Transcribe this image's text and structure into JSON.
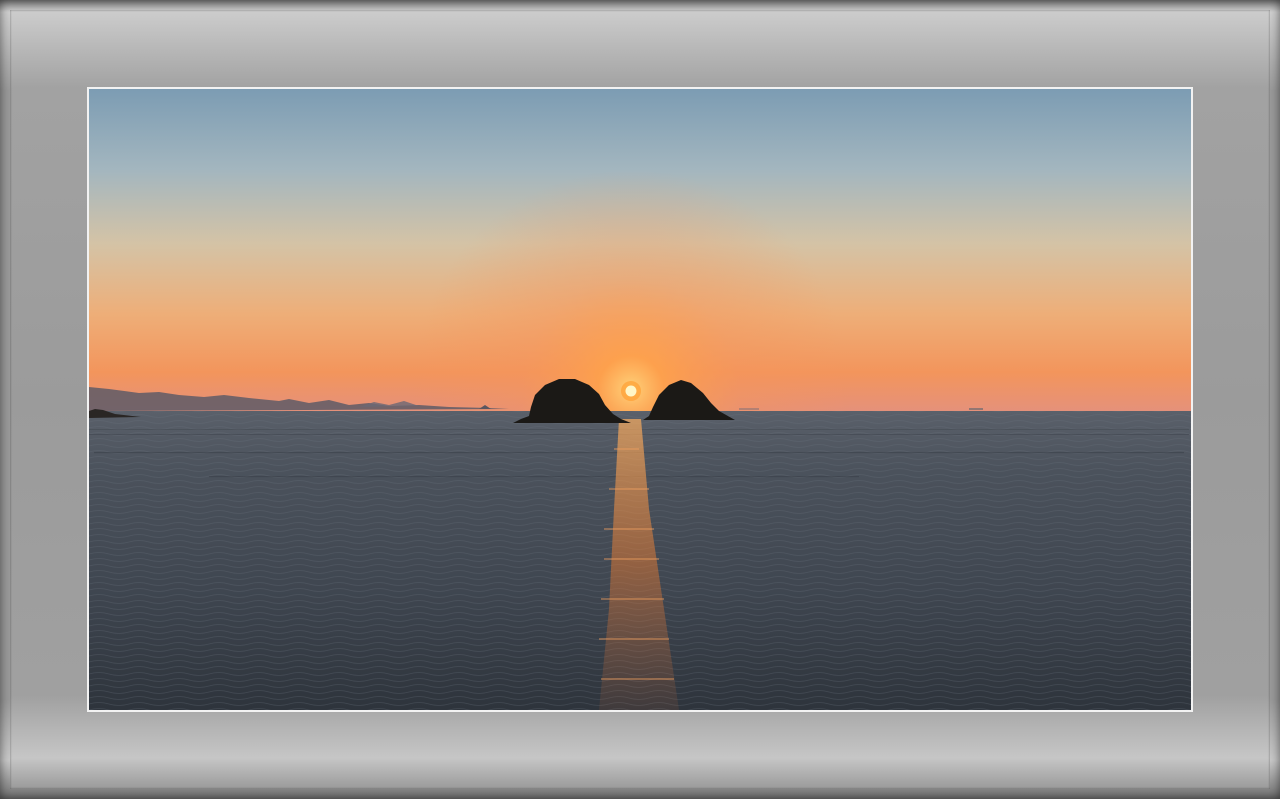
{
  "frame": {
    "colors": {
      "frame": "#9b9b9b",
      "photo_border": "#f2f2f2"
    }
  },
  "photo": {
    "scene": "sunset-over-sea-two-islands",
    "colors": {
      "sky_top": "#7f9fb4",
      "sky_mid": "#d9c2a2",
      "sky_horizon": "#f09a5a",
      "sun": "#fff4c0",
      "sun_glow": "#ff8a1e",
      "sea": "#3e4650",
      "island": "#1c1a17",
      "reflection": "#e27a33"
    }
  }
}
